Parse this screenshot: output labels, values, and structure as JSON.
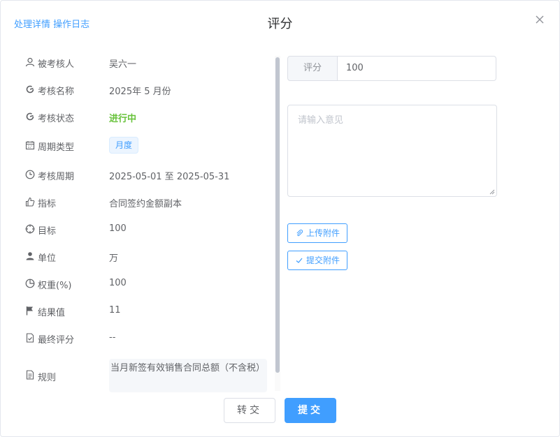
{
  "header": {
    "link_details": "处理详情",
    "link_log": "操作日志",
    "title": "评分"
  },
  "fields": [
    {
      "label": "被考核人",
      "value": "吴六一",
      "icon": "user-icon"
    },
    {
      "label": "考核名称",
      "value": "2025年 5 月份",
      "icon": "refresh-icon"
    },
    {
      "label": "考核状态",
      "value": "进行中",
      "icon": "refresh-icon"
    },
    {
      "label": "周期类型",
      "value": "月度",
      "icon": "calendar-icon"
    },
    {
      "label": "考核周期",
      "value": "2025-05-01 至 2025-05-31",
      "icon": "clock-icon"
    },
    {
      "label": "指标",
      "value": "合同签约金额副本",
      "icon": "thumb-icon"
    },
    {
      "label": "目标",
      "value": "100",
      "icon": "target-icon"
    },
    {
      "label": "单位",
      "value": "万",
      "icon": "person-icon"
    },
    {
      "label": "权重(%)",
      "value": "100",
      "icon": "pie-icon"
    },
    {
      "label": "结果值",
      "value": "11",
      "icon": "flag-icon"
    },
    {
      "label": "最终评分",
      "value": "--",
      "icon": "doc-check-icon"
    },
    {
      "label": "规则",
      "value": "当月新签有效销售合同总额（不含税）",
      "icon": "document-icon"
    }
  ],
  "score": {
    "prefix": "评分",
    "value": "100"
  },
  "opinion": {
    "placeholder": "请输入意见"
  },
  "buttons": {
    "upload": "上传附件",
    "submit_attachment": "提交附件",
    "transfer": "转交",
    "submit": "提交"
  },
  "colors": {
    "primary": "#409eff",
    "status_green": "#67c23a"
  }
}
